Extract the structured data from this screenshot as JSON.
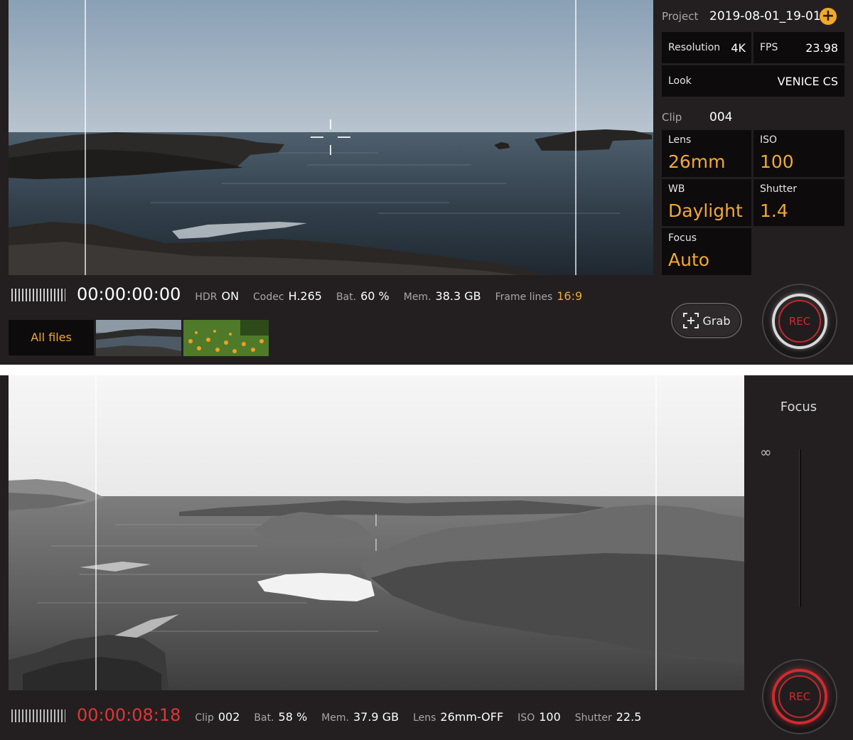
{
  "screen1": {
    "project": {
      "label": "Project",
      "value": "2019-08-01_19-01"
    },
    "resolution": {
      "label": "Resolution",
      "value": "4K"
    },
    "fps": {
      "label": "FPS",
      "value": "23.98"
    },
    "look": {
      "label": "Look",
      "value": "VENICE CS"
    },
    "clip": {
      "label": "Clip",
      "value": "004"
    },
    "lens": {
      "label": "Lens",
      "value": "26mm"
    },
    "iso": {
      "label": "ISO",
      "value": "100"
    },
    "wb": {
      "label": "WB",
      "value": "Daylight"
    },
    "shutter": {
      "label": "Shutter",
      "value": "1.4"
    },
    "focus": {
      "label": "Focus",
      "value": "Auto"
    },
    "status": {
      "timecode": "00:00:00:00",
      "hdr_label": "HDR",
      "hdr_value": "ON",
      "codec_label": "Codec",
      "codec_value": "H.265",
      "bat_label": "Bat.",
      "bat_value": "60 %",
      "mem_label": "Mem.",
      "mem_value": "38.3 GB",
      "framelines_label": "Frame lines",
      "framelines_value": "16:9"
    },
    "all_files": "All files",
    "grab": "Grab",
    "rec": "REC"
  },
  "screen2": {
    "focus_title": "Focus",
    "infinity": "∞",
    "rec": "REC",
    "status": {
      "timecode": "00:00:08:18",
      "clip_label": "Clip",
      "clip_value": "002",
      "bat_label": "Bat.",
      "bat_value": "58 %",
      "mem_label": "Mem.",
      "mem_value": "37.9 GB",
      "lens_label": "Lens",
      "lens_value": "26mm-OFF",
      "iso_label": "ISO",
      "iso_value": "100",
      "shutter_label": "Shutter",
      "shutter_value": "22.5"
    }
  },
  "colors": {
    "accent": "#f3a833",
    "rec_red": "#e03536",
    "panel": "#231f20",
    "cell": "#0d0b0c"
  }
}
